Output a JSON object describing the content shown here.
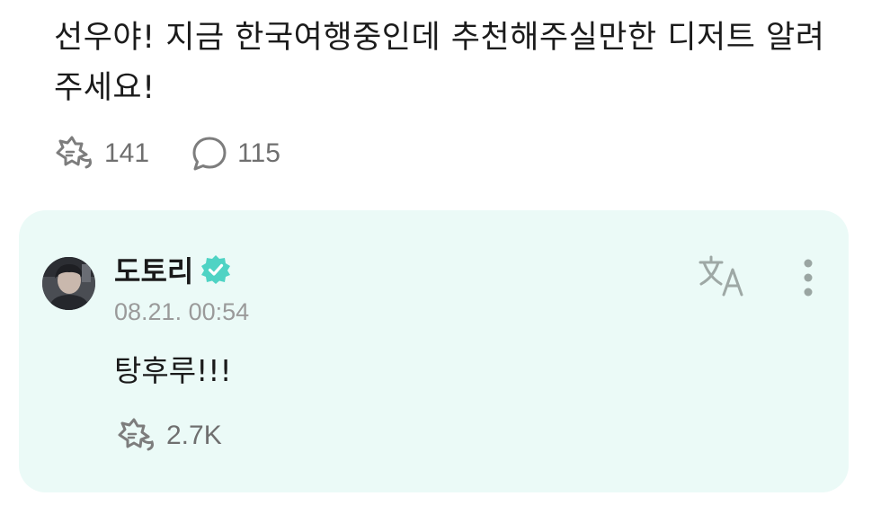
{
  "post": {
    "text": "선우야! 지금 한국여행중인데 추천해주실만한 디저트 알려주세요!",
    "like_icon": "like-icon",
    "like_count": "141",
    "comment_icon": "comment-icon",
    "comment_count": "115"
  },
  "comment": {
    "author": "도토리",
    "verified_icon": "verified-badge-icon",
    "timestamp": "08.21. 00:54",
    "body": "탕후루!!!",
    "like_count": "2.7K",
    "translate_icon": "translate-icon",
    "more_icon": "more-vertical-icon"
  },
  "colors": {
    "card_background": "#ebfaf7",
    "verified_badge": "#4fd3c4",
    "icon_gray": "#7d7d7d",
    "meta_gray": "#9a9a9a"
  }
}
